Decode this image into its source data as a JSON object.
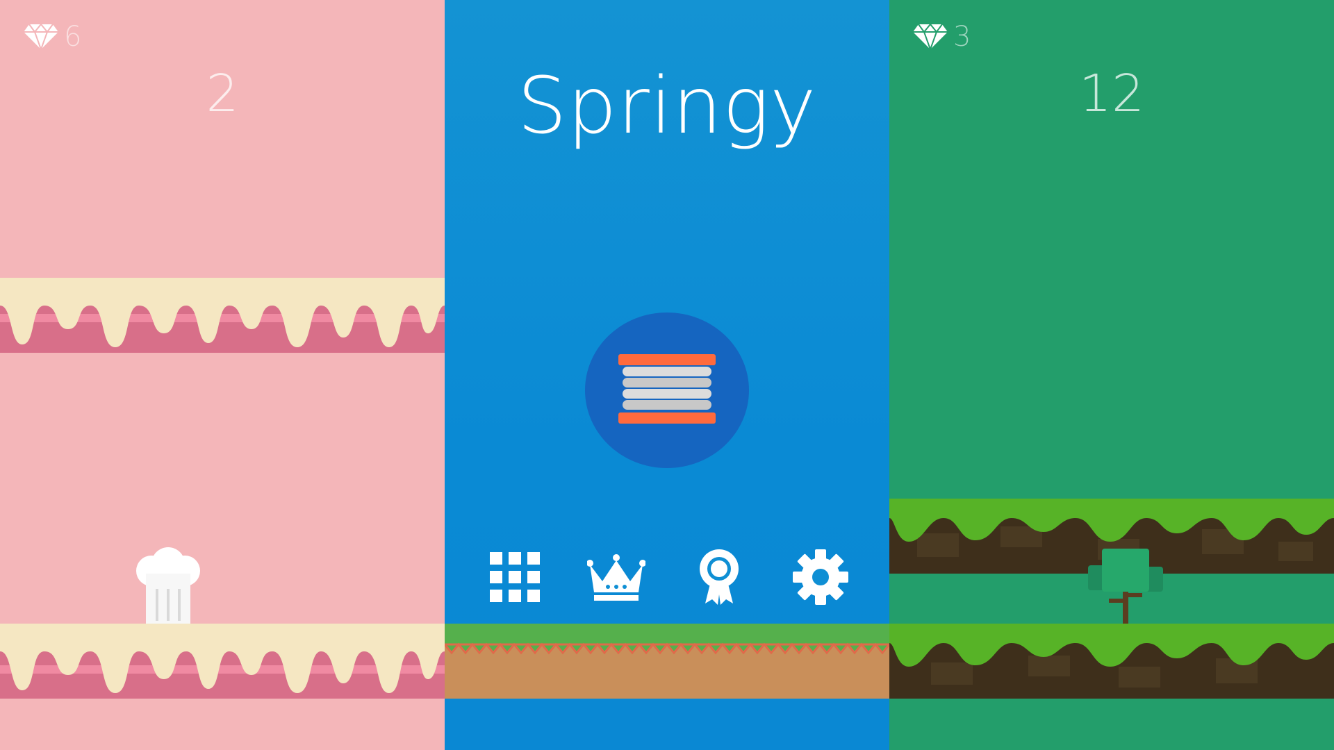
{
  "left_panel": {
    "gems": "6",
    "score": "2",
    "theme": "cake",
    "colors": {
      "background": "#f4b6b9",
      "cake": "#d86f89",
      "cream": "#f5e7c2",
      "stripe": "#f08aa2"
    }
  },
  "middle_panel": {
    "title": "Springy",
    "logo_icon": "spring-icon",
    "menu": [
      {
        "name": "levels-grid-icon"
      },
      {
        "name": "leaderboard-crown-icon"
      },
      {
        "name": "achievements-ribbon-icon"
      },
      {
        "name": "settings-gear-icon"
      }
    ],
    "colors": {
      "background": "#0f8fd4",
      "circle": "#1565c0",
      "grass": "#55b04c",
      "dirt": "#c98f5a"
    }
  },
  "right_panel": {
    "gems": "3",
    "score": "12",
    "theme": "forest",
    "colors": {
      "background": "#239e6b",
      "grass": "#57b327",
      "dirt": "#3e2f1b"
    }
  }
}
